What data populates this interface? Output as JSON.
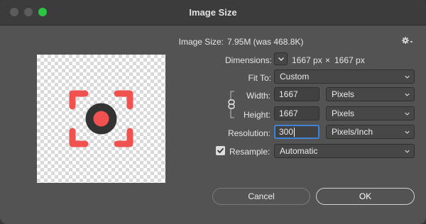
{
  "window": {
    "title": "Image Size",
    "colors": {
      "close": "#5c5c5c",
      "minimize": "#5c5c5c",
      "maximize": "#2ac840"
    }
  },
  "preview": {
    "icon": "camera-focus-target-icon",
    "colors": {
      "brackets": "#f0524f",
      "ring": "#333333",
      "dot": "#f0524f"
    }
  },
  "info": {
    "image_size_label": "Image Size:",
    "image_size_value": "7.95M (was 468.8K)",
    "settings_icon": "gear-icon",
    "dimensions_label": "Dimensions:",
    "dimensions_width": "1667 px",
    "dimensions_sep": "×",
    "dimensions_height": "1667 px"
  },
  "form": {
    "fit_to_label": "Fit To:",
    "fit_to_value": "Custom",
    "width_label": "Width:",
    "width_value": "1667",
    "width_unit": "Pixels",
    "height_label": "Height:",
    "height_value": "1667",
    "height_unit": "Pixels",
    "link_icon": "chain-link-icon",
    "resolution_label": "Resolution:",
    "resolution_value": "300",
    "resolution_unit": "Pixels/Inch",
    "resample_label": "Resample:",
    "resample_checked": true,
    "resample_value": "Automatic"
  },
  "buttons": {
    "cancel": "Cancel",
    "ok": "OK"
  },
  "colors": {
    "focus_ring": "#3d83d8",
    "dialog_bg": "#535353"
  }
}
